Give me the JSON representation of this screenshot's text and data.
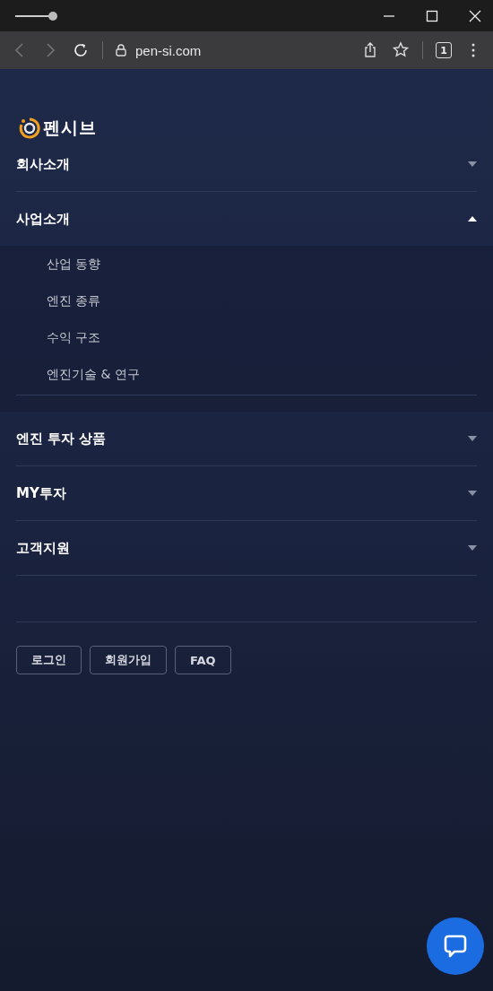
{
  "browser": {
    "url": "pen-si.com",
    "tab_count": "1"
  },
  "logo": {
    "text": "펜시브"
  },
  "menu": [
    {
      "label": "회사소개",
      "expanded": false
    },
    {
      "label": "사업소개",
      "expanded": true,
      "children": [
        {
          "label": "산업 동향"
        },
        {
          "label": "엔진 종류"
        },
        {
          "label": "수익 구조"
        },
        {
          "label": "엔진기술 & 연구"
        }
      ]
    },
    {
      "label": "엔진 투자 상품",
      "expanded": false
    },
    {
      "label": "MY투자",
      "expanded": false
    },
    {
      "label": "고객지원",
      "expanded": false
    }
  ],
  "buttons": [
    "로그인",
    "회원가입",
    "FAQ"
  ]
}
